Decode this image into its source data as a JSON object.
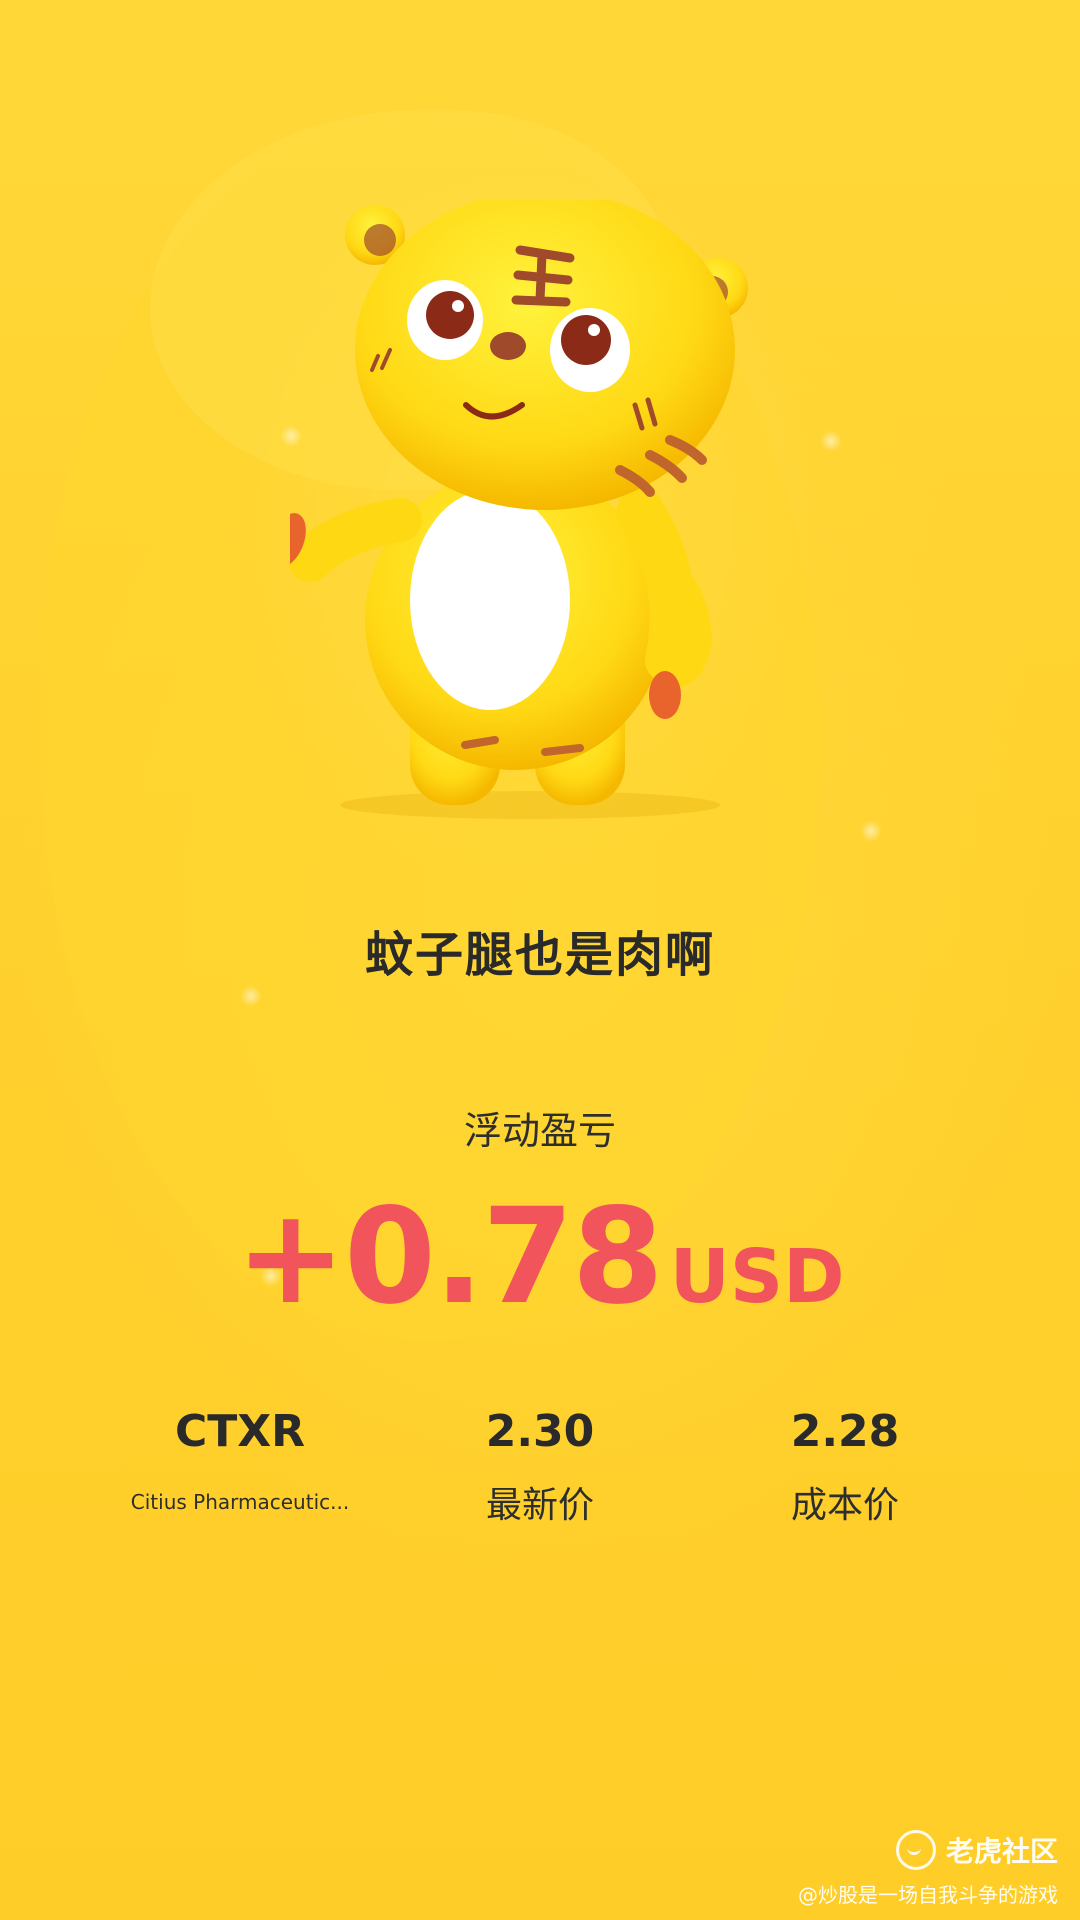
{
  "card": {
    "nickname": "蚊子腿也是肉啊",
    "pl_label": "浮动盈亏",
    "pl_amount": "+0.78",
    "pl_unit": "USD",
    "pl_color": "#F2545B",
    "background_color": "#FFD12E"
  },
  "stats": {
    "symbol": "CTXR",
    "company": "Citius Pharmaceutic...",
    "latest_price": "2.30",
    "latest_price_label": "最新价",
    "cost_price": "2.28",
    "cost_price_label": "成本价"
  },
  "watermark": {
    "brand": "老虎社区",
    "author": "@炒股是一场自我斗争的游戏",
    "icon": "tiger-community-icon"
  },
  "mascot": {
    "icon": "tiger-mascot-icon"
  }
}
